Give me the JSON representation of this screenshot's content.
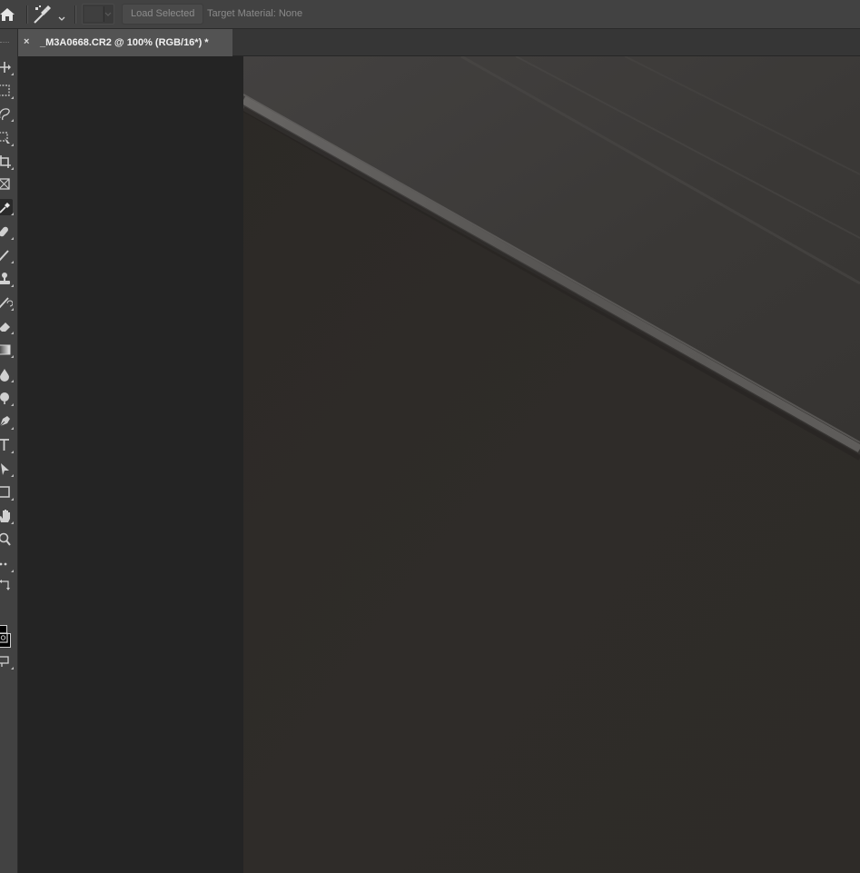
{
  "options_bar": {
    "load_selected_label": "Load Selected",
    "target_material_label": "Target Material: None"
  },
  "document": {
    "tab_title": "_M3A0668.CR2 @ 100% (RGB/16*) *",
    "close_glyph": "×"
  },
  "toolbar": {
    "tools": [
      {
        "name": "move-tool",
        "icon": "move-icon"
      },
      {
        "name": "marquee-tool",
        "icon": "marquee-icon"
      },
      {
        "name": "lasso-tool",
        "icon": "lasso-icon"
      },
      {
        "name": "object-selection-tool",
        "icon": "object-selection-icon"
      },
      {
        "name": "crop-tool",
        "icon": "crop-icon"
      },
      {
        "name": "frame-tool",
        "icon": "frame-icon"
      },
      {
        "name": "eyedropper-tool",
        "icon": "eyedropper-icon",
        "active": true
      },
      {
        "name": "healing-brush-tool",
        "icon": "bandage-icon"
      },
      {
        "name": "brush-tool",
        "icon": "brush-icon"
      },
      {
        "name": "clone-stamp-tool",
        "icon": "stamp-icon"
      },
      {
        "name": "history-brush-tool",
        "icon": "history-brush-icon"
      },
      {
        "name": "eraser-tool",
        "icon": "eraser-icon"
      },
      {
        "name": "gradient-tool",
        "icon": "gradient-icon"
      },
      {
        "name": "blur-tool",
        "icon": "droplet-icon"
      },
      {
        "name": "dodge-tool",
        "icon": "dodge-icon"
      },
      {
        "name": "pen-tool",
        "icon": "pen-icon"
      },
      {
        "name": "type-tool",
        "icon": "type-icon"
      },
      {
        "name": "path-selection-tool",
        "icon": "arrow-icon"
      },
      {
        "name": "rectangle-tool",
        "icon": "rectangle-icon"
      },
      {
        "name": "hand-tool",
        "icon": "hand-icon"
      },
      {
        "name": "zoom-tool",
        "icon": "magnifier-icon"
      },
      {
        "name": "edit-toolbar",
        "icon": "ellipsis-icon"
      }
    ],
    "foreground_color": "#000000",
    "background_color": "#000000"
  },
  "canvas": {
    "base_color": "#2e2b28",
    "wall_color": "#3d3b39",
    "edge_highlight": "#6a6866"
  }
}
